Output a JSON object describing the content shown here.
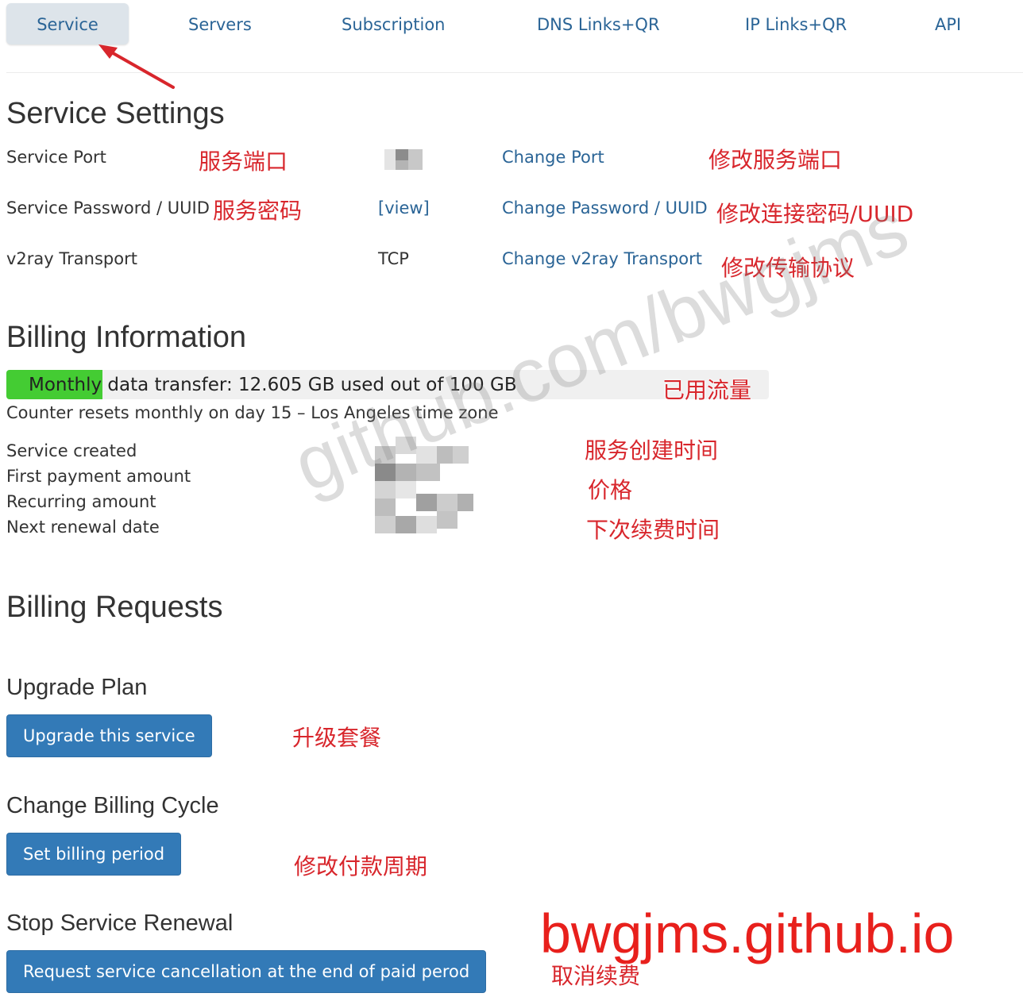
{
  "tabs": [
    {
      "label": "Service",
      "active": true
    },
    {
      "label": "Servers"
    },
    {
      "label": "Subscription"
    },
    {
      "label": "DNS Links+QR"
    },
    {
      "label": "IP Links+QR"
    },
    {
      "label": "API"
    }
  ],
  "service_settings": {
    "title": "Service Settings",
    "rows": [
      {
        "label": "Service Port",
        "value": "",
        "action": "Change Port",
        "note_cn": "服务端口",
        "action_note_cn": "修改服务端口"
      },
      {
        "label": "Service Password / UUID",
        "value": "[view]",
        "action": "Change Password / UUID",
        "note_cn": "服务密码",
        "action_note_cn": "修改连接密码/UUID"
      },
      {
        "label": "v2ray Transport",
        "value": "TCP",
        "action": "Change v2ray Transport",
        "action_note_cn": "修改传输协议"
      }
    ]
  },
  "billing_info": {
    "title": "Billing Information",
    "progress_label": "Monthly data transfer: 12.605 GB used out of 100 GB",
    "progress_fraction": 0.126,
    "progress_note_cn": "已用流量",
    "reset_note": "Counter resets monthly on day 15 – Los Angeles time zone",
    "fields": [
      {
        "label": "Service created",
        "note_cn": "服务创建时间"
      },
      {
        "label": "First payment amount",
        "note_cn": "价格"
      },
      {
        "label": "Recurring amount"
      },
      {
        "label": "Next renewal date",
        "note_cn": "下次续费时间"
      }
    ]
  },
  "billing_requests": {
    "title": "Billing Requests",
    "upgrade": {
      "heading": "Upgrade Plan",
      "button": "Upgrade this service",
      "note_cn": "升级套餐"
    },
    "cycle": {
      "heading": "Change Billing Cycle",
      "button": "Set billing period",
      "note_cn": "修改付款周期"
    },
    "stop": {
      "heading": "Stop Service Renewal",
      "button": "Request service cancellation at the end of paid perod",
      "note_cn": "取消续费"
    }
  },
  "watermark": "github.com/bwgjms",
  "brand": "bwgjms.github.io",
  "colors": {
    "link": "#2a6496",
    "button": "#337ab7",
    "progress": "#44cc33",
    "annotation": "#d8262c"
  }
}
